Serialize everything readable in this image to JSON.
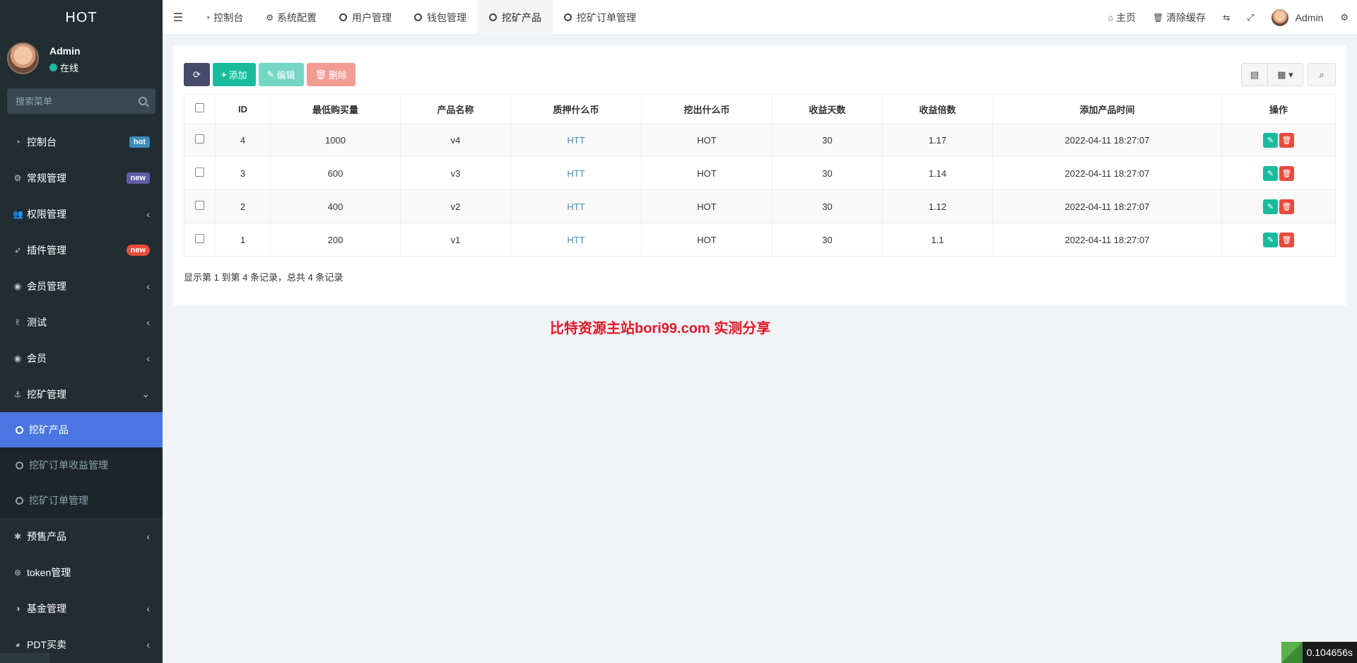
{
  "app": {
    "logo": "HOT"
  },
  "user": {
    "name": "Admin",
    "status": "在线"
  },
  "sidebar": {
    "search_placeholder": "搜索菜单",
    "items": [
      {
        "icon": "dashboard-icon",
        "glyph": "◔",
        "label": "控制台",
        "badge": "hot"
      },
      {
        "icon": "cogs-icon",
        "glyph": "⚙",
        "label": "常规管理",
        "badge": "new"
      },
      {
        "icon": "users-icon",
        "glyph": "👥",
        "label": "权限管理"
      },
      {
        "icon": "rocket-icon",
        "glyph": "➶",
        "label": "插件管理",
        "badge": "new"
      },
      {
        "icon": "user-circle-icon",
        "glyph": "◉",
        "label": "会员管理"
      },
      {
        "icon": "hand-peace-icon",
        "glyph": "✌",
        "label": "测试"
      },
      {
        "icon": "user-circle-icon",
        "glyph": "◉",
        "label": "会员"
      },
      {
        "icon": "anchor-icon",
        "glyph": "⚓",
        "label": "挖矿管理"
      },
      {
        "icon": "yelp-icon",
        "glyph": "✱",
        "label": "预售产品"
      },
      {
        "icon": "globe-icon",
        "glyph": "⊛",
        "label": "token管理"
      },
      {
        "icon": "adjust-icon",
        "glyph": "◑",
        "label": "基金管理"
      },
      {
        "icon": "compass-icon",
        "glyph": "◕",
        "label": "PDT买卖"
      }
    ],
    "submenu": [
      "挖矿产品",
      "挖矿订单收益管理",
      "挖矿订单管理"
    ]
  },
  "topbar": {
    "tabs": [
      "控制台",
      "系统配置",
      "用户管理",
      "钱包管理",
      "挖矿产品",
      "挖矿订单管理"
    ],
    "home": "主页",
    "clear_cache": "清除缓存",
    "user": "Admin"
  },
  "toolbar": {
    "add": "添加",
    "edit": "编辑",
    "delete": "删除"
  },
  "table": {
    "headers": [
      "ID",
      "最低购买量",
      "产品名称",
      "质押什么币",
      "挖出什么币",
      "收益天数",
      "收益倍数",
      "添加产品时间",
      "操作"
    ],
    "rows": [
      [
        "4",
        "1000",
        "v4",
        "HTT",
        "HOT",
        "30",
        "1.17",
        "2022-04-11 18:27:07"
      ],
      [
        "3",
        "600",
        "v3",
        "HTT",
        "HOT",
        "30",
        "1.14",
        "2022-04-11 18:27:07"
      ],
      [
        "2",
        "400",
        "v2",
        "HTT",
        "HOT",
        "30",
        "1.12",
        "2022-04-11 18:27:07"
      ],
      [
        "1",
        "200",
        "v1",
        "HTT",
        "HOT",
        "30",
        "1.1",
        "2022-04-11 18:27:07"
      ]
    ],
    "summary": "显示第 1 到第 4 条记录，总共 4 条记录"
  },
  "watermark": "比特资源主站bori99.com  实测分享",
  "timer": "0.104656s",
  "colors": {
    "sidebar": "#222d32",
    "accent": "#18bc9c",
    "active": "#4b76e1",
    "danger": "#e74c3c"
  }
}
